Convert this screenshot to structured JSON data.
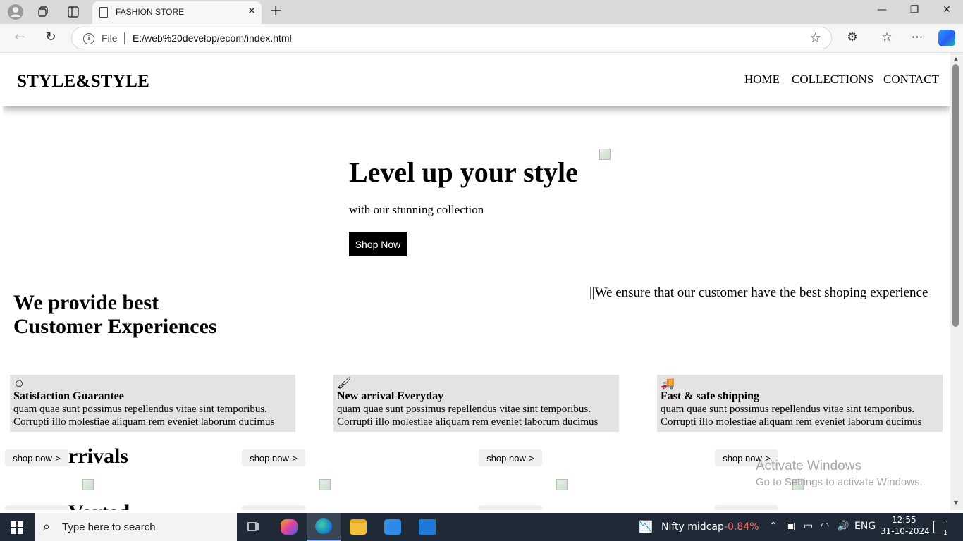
{
  "browser": {
    "tab_title": "FASHION STORE",
    "tab_close": "✕",
    "new_tab": "+",
    "address_file_label": "File",
    "url": "E:/web%20develop/ecom/index.html",
    "window_controls": {
      "minimize": "—",
      "restore": "❐",
      "close": "✕"
    }
  },
  "site": {
    "logo": "STYLE&STYLE",
    "nav": [
      "HOME",
      "COLLECTIONS",
      "CONTACT"
    ],
    "hero": {
      "title": "Level up your style",
      "subtitle": "with our stunning collection",
      "button": "Shop Now"
    },
    "marquee": "||We ensure that our customer have the best shoping experience",
    "cx_heading_line1": "We provide best",
    "cx_heading_line2": "Customer Experiences",
    "features": [
      {
        "icon": "smile-icon",
        "glyph": "☺",
        "title": "Satisfaction Guarantee",
        "line1": "quam quae sunt possimus repellendus vitae sint temporibus.",
        "line2": "Corrupti illo molestiae aliquam rem eveniet laborum ducimus"
      },
      {
        "icon": "brush-icon",
        "glyph": "🖌",
        "title": "New arrival Everyday",
        "line1": "quam quae sunt possimus repellendus vitae sint temporibus.",
        "line2": "Corrupti illo molestiae aliquam rem eveniet laborum ducimus"
      },
      {
        "icon": "truck-icon",
        "glyph": "🚚",
        "title": "Fast & safe shipping",
        "line1": "quam quae sunt possimus repellendus vitae sint temporibus.",
        "line2": "Corrupti illo molestiae aliquam rem eveniet laborum ducimus"
      }
    ],
    "arrivals_heading": "rrivals",
    "arrivals_heading_2": "Vorted",
    "shop_now_label": "shop now->",
    "watermark_line1": "Activate Windows",
    "watermark_line2": "Go to Settings to activate Windows."
  },
  "taskbar": {
    "search_placeholder": "Type here to search",
    "stock_name": "Nifty midcap",
    "stock_change": "-0.84%",
    "language": "ENG",
    "time": "12:55",
    "date": "31-10-2024",
    "notification_count": "1"
  },
  "colors": {
    "feature_bg": "#e4e2e2",
    "hero_button_bg": "#000000",
    "taskbar_bg": "#1f2a36",
    "stock_negative": "#ff6b6b"
  }
}
